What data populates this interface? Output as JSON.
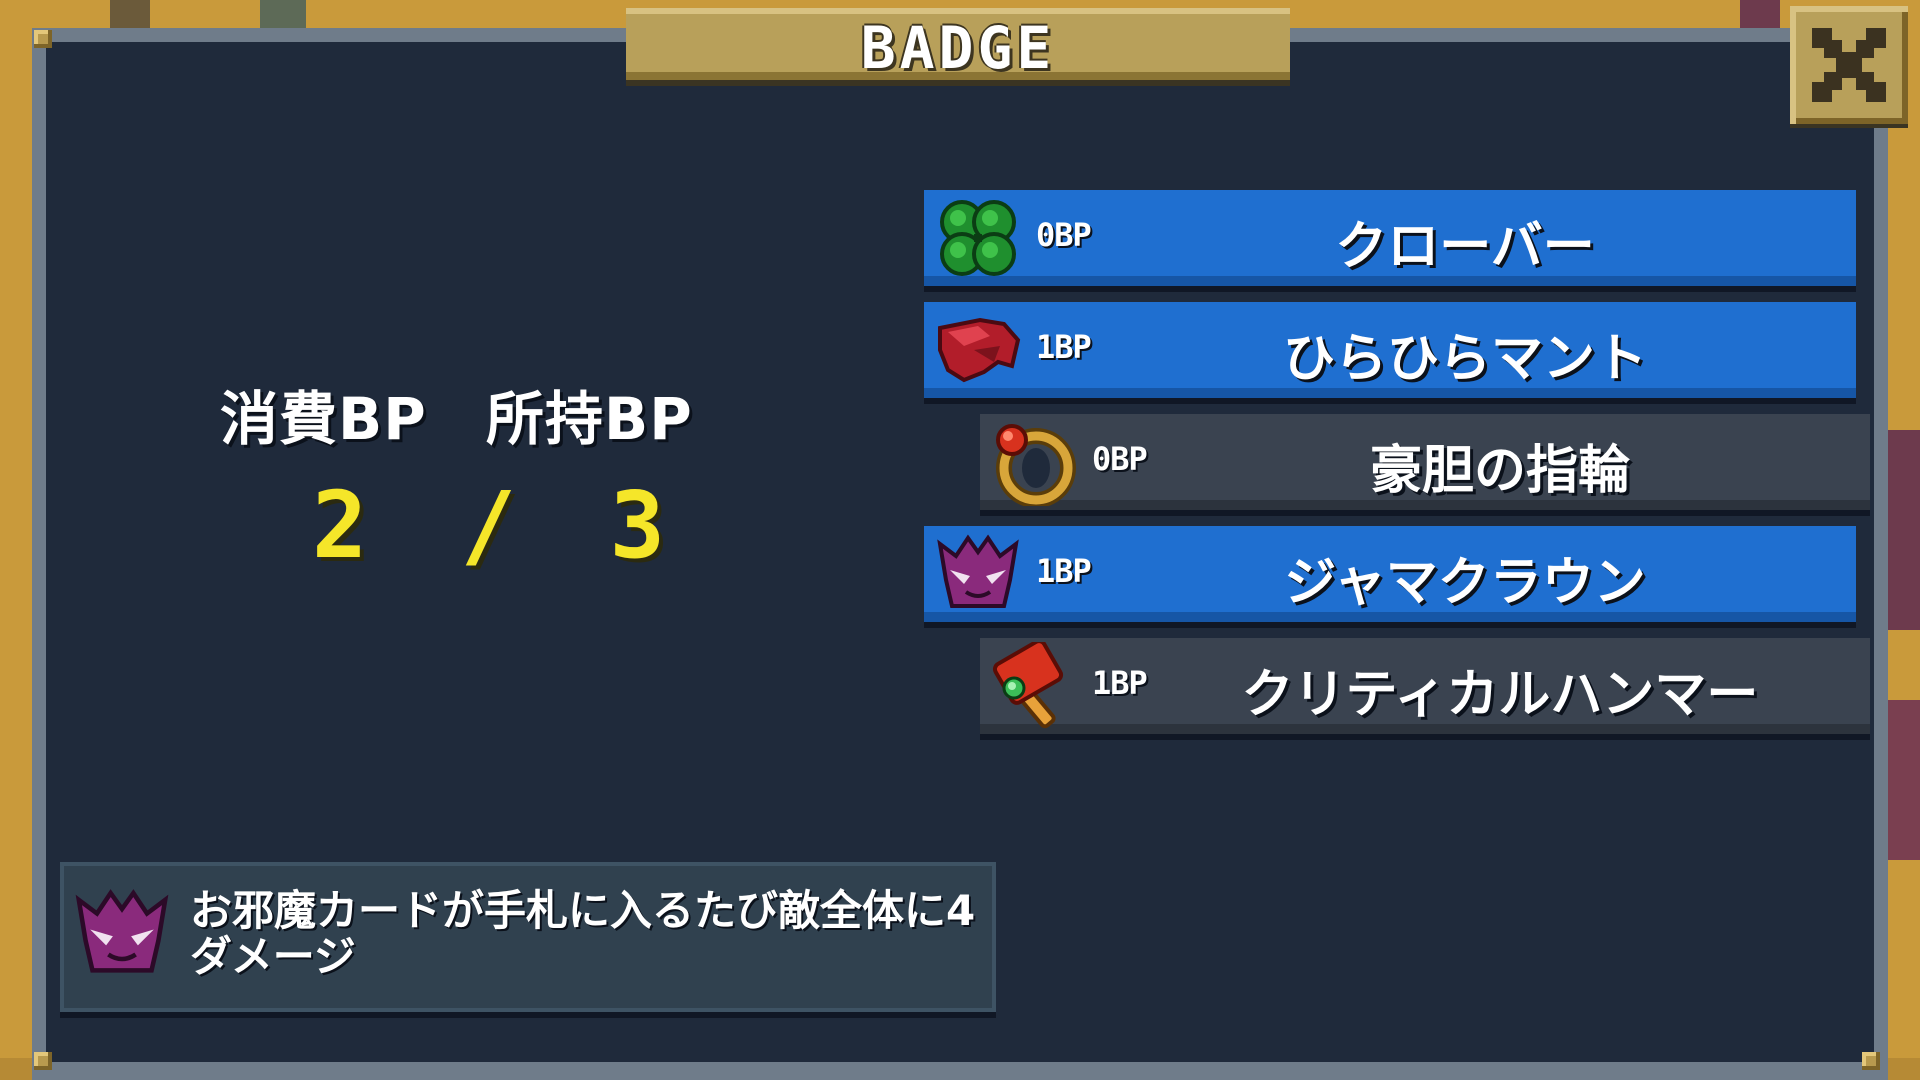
{
  "window": {
    "title": "BADGE"
  },
  "bp_summary": {
    "used_label": "消費BP",
    "owned_label": "所持BP",
    "used_value": "2",
    "separator": "/",
    "owned_value": "3"
  },
  "badges": [
    {
      "cost": "0BP",
      "name": "クローバー",
      "equipped": true,
      "icon": "clover-icon"
    },
    {
      "cost": "1BP",
      "name": "ひらひらマント",
      "equipped": true,
      "icon": "red-cape-icon"
    },
    {
      "cost": "0BP",
      "name": "豪胆の指輪",
      "equipped": false,
      "icon": "ring-icon"
    },
    {
      "cost": "1BP",
      "name": "ジャマクラウン",
      "equipped": true,
      "icon": "jama-crown-icon"
    },
    {
      "cost": "1BP",
      "name": "クリティカルハンマー",
      "equipped": false,
      "icon": "critical-hammer-icon"
    }
  ],
  "description": {
    "icon": "jama-crown-icon",
    "text": "お邪魔カードが手札に入るたび敵全体に4ダメージ"
  },
  "colors": {
    "equipped_row": "#1f6fd0",
    "unequipped_row": "#3a4350",
    "panel": "#1f2a3b",
    "bp_value": "#f5e629",
    "frame_gold": "#b8a05a"
  }
}
